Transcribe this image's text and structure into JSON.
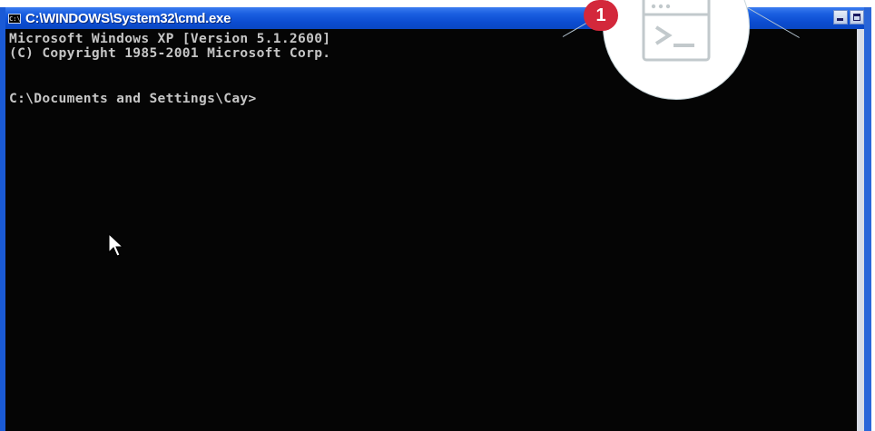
{
  "window": {
    "title": "C:\\WINDOWS\\System32\\cmd.exe",
    "icon_text": "C:\\"
  },
  "console": {
    "lines": [
      "Microsoft Windows XP [Version 5.1.2600]",
      "(C) Copyright 1985-2001 Microsoft Corp.",
      "",
      "C:\\Documents and Settings\\Cay>"
    ]
  },
  "overlay": {
    "step_number": "1",
    "icon": "terminal-icon"
  },
  "colors": {
    "titlebar": "#0b4cd0",
    "console_bg": "#050505",
    "console_text": "#c6c6c6",
    "badge": "#d3283b"
  }
}
